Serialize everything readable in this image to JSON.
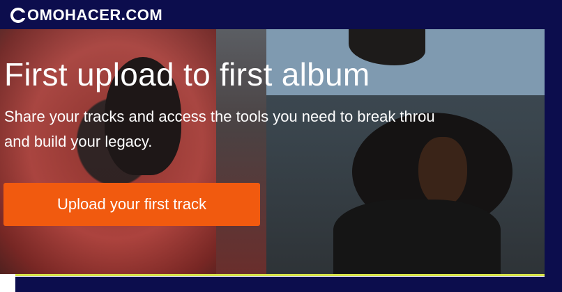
{
  "watermark": {
    "brand_text": "COMOHACER.COM",
    "colors": {
      "bar": "#0c0d4d",
      "accent_line": "#d8e44a",
      "text": "#ffffff"
    }
  },
  "hero": {
    "headline": "First upload to first album",
    "subtext_line1": "Share your tracks and access the tools you need to break throu",
    "subtext_line2": "and build your legacy.",
    "cta_label": "Upload your first track",
    "cta_color": "#f15a0f"
  }
}
